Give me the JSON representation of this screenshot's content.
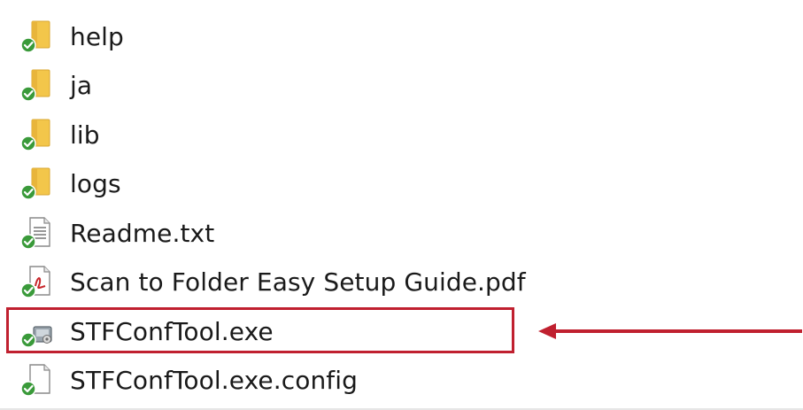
{
  "file_list": {
    "items": [
      {
        "name": "help",
        "icon": "folder-icon",
        "sync_status": "synced"
      },
      {
        "name": "ja",
        "icon": "folder-icon",
        "sync_status": "synced"
      },
      {
        "name": "lib",
        "icon": "folder-icon",
        "sync_status": "synced"
      },
      {
        "name": "logs",
        "icon": "folder-icon",
        "sync_status": "synced"
      },
      {
        "name": "Readme.txt",
        "icon": "text-file-icon",
        "sync_status": "synced"
      },
      {
        "name": "Scan to Folder Easy Setup Guide.pdf",
        "icon": "pdf-file-icon",
        "sync_status": "synced"
      },
      {
        "name": "STFConfTool.exe",
        "icon": "exe-file-icon",
        "sync_status": "synced",
        "highlighted": true
      },
      {
        "name": "STFConfTool.exe.config",
        "icon": "config-file-icon",
        "sync_status": "synced"
      }
    ]
  },
  "annotation": {
    "highlight_color": "#c0202f",
    "arrow_direction": "left",
    "target": "STFConfTool.exe"
  },
  "colors": {
    "folder_yellow": "#f3c64a",
    "sync_green": "#3a9a3a",
    "text": "#1a1a1a"
  }
}
